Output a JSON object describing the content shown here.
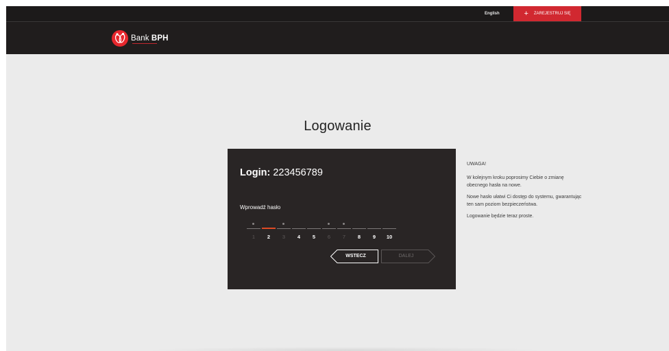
{
  "topbar": {
    "language_link": "English",
    "register_label": "ZAREJESTRUJ SIĘ",
    "register_icon": "plus-icon",
    "accent_color": "#d12830"
  },
  "header": {
    "brand_prefix": "Bank",
    "brand_name": "BPH",
    "logo_icon": "bank-bph-logo"
  },
  "page": {
    "title": "Logowanie"
  },
  "login_panel": {
    "login_label": "Login:",
    "login_value": "223456789",
    "password_label": "Wprowadź hasło",
    "password_slots": [
      {
        "number": "1",
        "enabled": false,
        "filled": true,
        "active": false
      },
      {
        "number": "2",
        "enabled": true,
        "filled": false,
        "active": true
      },
      {
        "number": "3",
        "enabled": false,
        "filled": true,
        "active": false
      },
      {
        "number": "4",
        "enabled": true,
        "filled": false,
        "active": false
      },
      {
        "number": "5",
        "enabled": true,
        "filled": false,
        "active": false
      },
      {
        "number": "6",
        "enabled": false,
        "filled": true,
        "active": false
      },
      {
        "number": "7",
        "enabled": false,
        "filled": true,
        "active": false
      },
      {
        "number": "8",
        "enabled": true,
        "filled": false,
        "active": false
      },
      {
        "number": "9",
        "enabled": true,
        "filled": false,
        "active": false
      },
      {
        "number": "10",
        "enabled": true,
        "filled": false,
        "active": false
      }
    ],
    "back_button": "WSTECZ",
    "next_button": "DALEJ"
  },
  "notice": {
    "heading": "UWAGA!",
    "paragraph_1": "W kolejnym kroku poprosimy Ciebie o zmianę obecnego hasła na nowe.",
    "paragraph_2": "Nowe hasło ułatwi Ci dostęp do systemu, gwarantując ten sam poziom bezpieczeństwa.",
    "paragraph_3": "Logowanie będzie teraz proste."
  }
}
